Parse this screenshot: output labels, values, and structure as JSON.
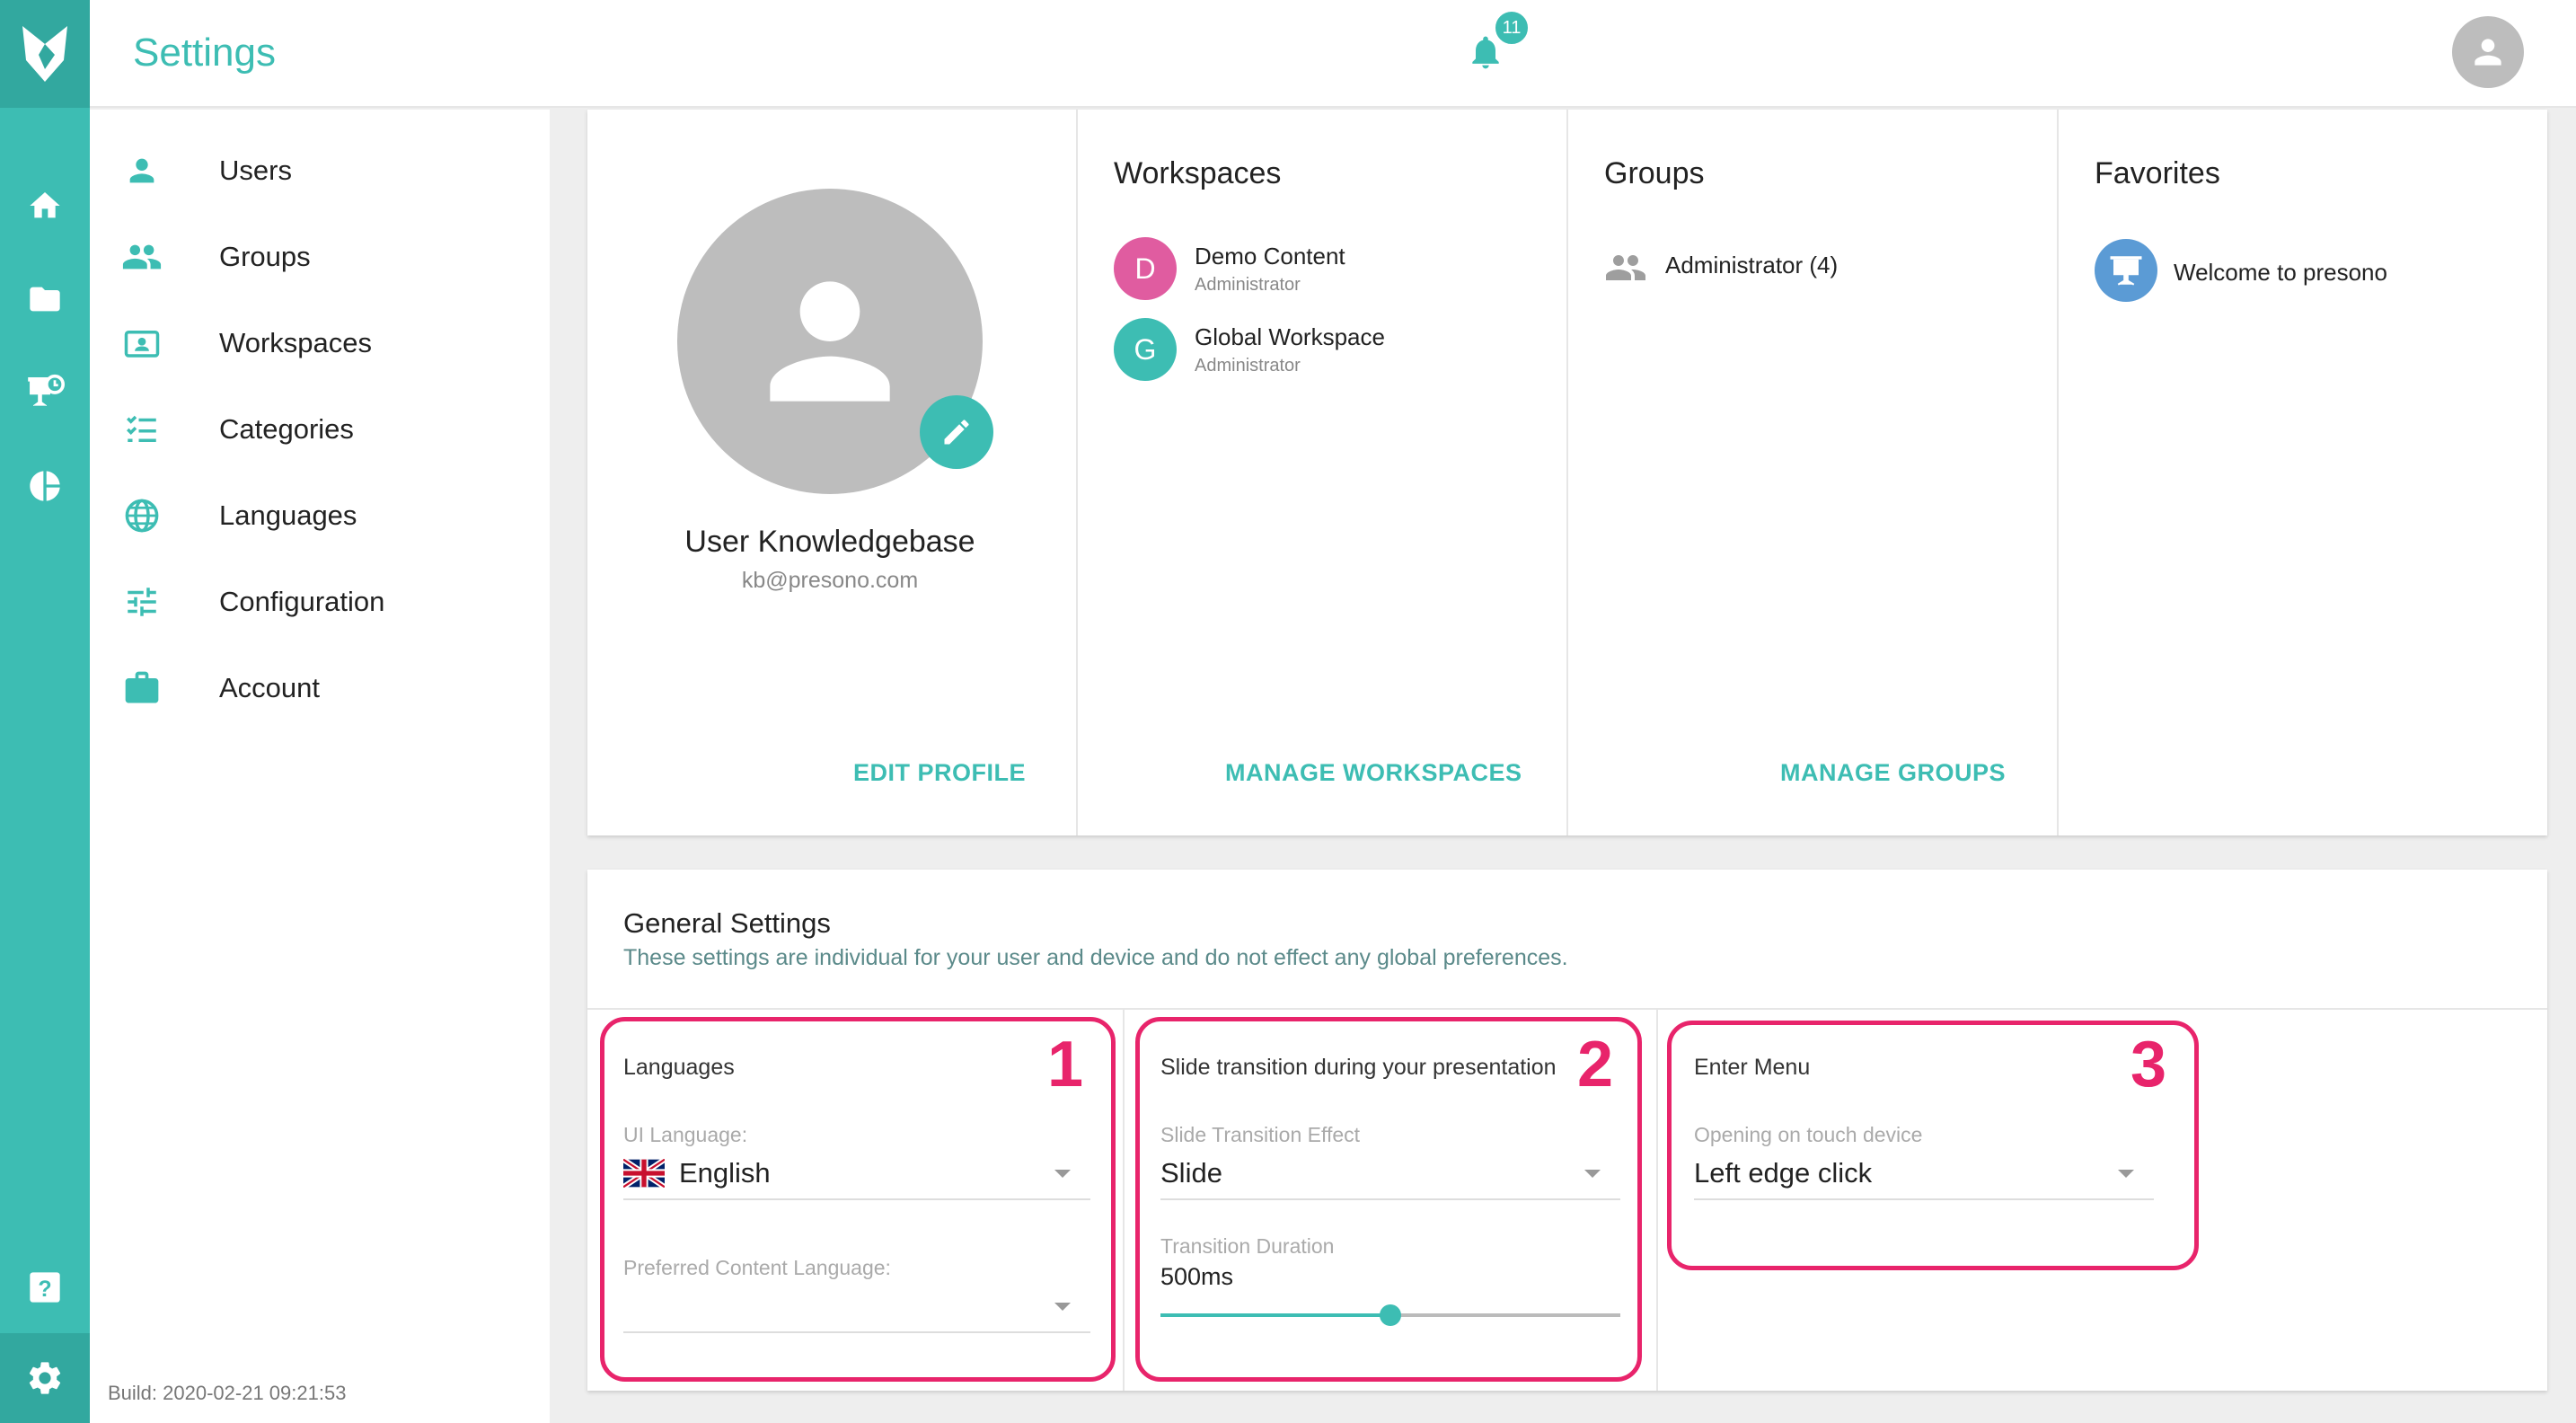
{
  "header": {
    "title": "Settings",
    "notification_count": "11"
  },
  "sidebar": {
    "items": [
      {
        "label": "Users",
        "icon": "person-icon"
      },
      {
        "label": "Groups",
        "icon": "people-icon"
      },
      {
        "label": "Workspaces",
        "icon": "workspace-folder-icon"
      },
      {
        "label": "Categories",
        "icon": "checklist-icon"
      },
      {
        "label": "Languages",
        "icon": "globe-icon"
      },
      {
        "label": "Configuration",
        "icon": "sliders-icon"
      },
      {
        "label": "Account",
        "icon": "briefcase-icon"
      }
    ],
    "build": "Build: 2020-02-21 09:21:53"
  },
  "profile": {
    "name": "User Knowledgebase",
    "email": "kb@presono.com",
    "action": "EDIT PROFILE"
  },
  "workspaces": {
    "title": "Workspaces",
    "items": [
      {
        "initial": "D",
        "name": "Demo Content",
        "role": "Administrator",
        "color": "#e05ca0"
      },
      {
        "initial": "G",
        "name": "Global Workspace",
        "role": "Administrator",
        "color": "#3dbdb3"
      }
    ],
    "action": "MANAGE WORKSPACES"
  },
  "groups": {
    "title": "Groups",
    "items": [
      {
        "label": "Administrator (4)"
      }
    ],
    "action": "MANAGE GROUPS"
  },
  "favorites": {
    "title": "Favorites",
    "items": [
      {
        "label": "Welcome to presono"
      }
    ]
  },
  "general": {
    "title": "General Settings",
    "subtitle": "These settings are individual for your user and device and do not effect any global preferences.",
    "languages": {
      "title": "Languages",
      "ui_label": "UI Language:",
      "ui_value": "English",
      "content_label": "Preferred Content Language:",
      "content_value": ""
    },
    "transition": {
      "title": "Slide transition during your presentation",
      "effect_label": "Slide Transition Effect",
      "effect_value": "Slide",
      "duration_label": "Transition Duration",
      "duration_value": "500ms",
      "slider_fraction": 0.5
    },
    "menu": {
      "title": "Enter Menu",
      "label": "Opening on touch device",
      "value": "Left edge click"
    }
  },
  "annotations": [
    "1",
    "2",
    "3"
  ],
  "colors": {
    "accent": "#3dbdb3",
    "highlight": "#e8246b"
  }
}
